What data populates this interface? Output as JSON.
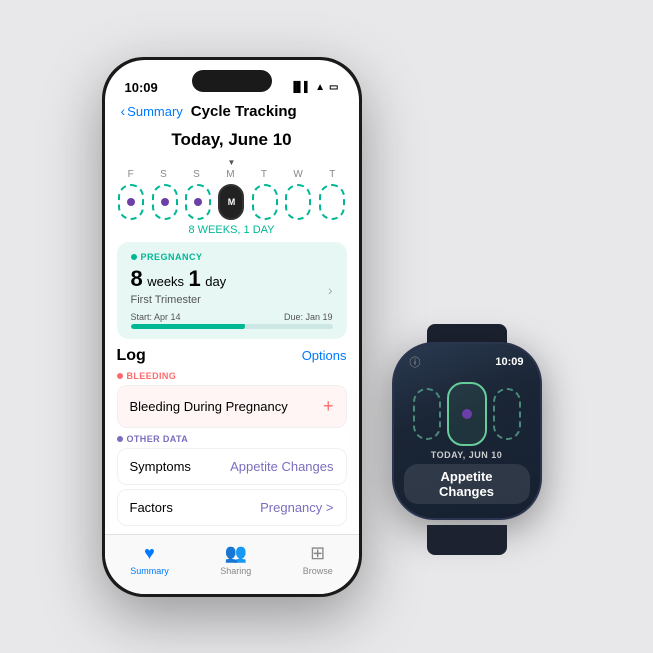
{
  "background_color": "#e8e8ea",
  "iphone": {
    "status_bar": {
      "time": "10:09",
      "signal": "●●●",
      "wifi": "wifi",
      "battery": "battery"
    },
    "nav": {
      "back_label": "Summary",
      "title": "Cycle Tracking"
    },
    "date_header": "Today, June 10",
    "calendar": {
      "day_labels": [
        "F",
        "S",
        "S",
        "M",
        "T",
        "W",
        "T"
      ],
      "today_marker": "M",
      "week_label": "8 WEEKS, 1 DAY"
    },
    "pregnancy_card": {
      "category": "PREGNANCY",
      "weeks": "8",
      "weeks_unit": "weeks",
      "days": "1",
      "days_unit": "day",
      "trimester": "First Trimester",
      "start_label": "Start: Apr 14",
      "due_label": "Due: Jan 19",
      "progress_percent": 55
    },
    "log_section": {
      "title": "Log",
      "options_label": "Options",
      "bleeding_category": "BLEEDING",
      "bleeding_row_label": "Bleeding During Pregnancy",
      "other_category": "OTHER DATA",
      "symptoms_label": "Symptoms",
      "symptoms_value": "Appetite Changes",
      "factors_label": "Factors",
      "factors_value": "Pregnancy >"
    },
    "tab_bar": {
      "tabs": [
        {
          "label": "Summary",
          "active": true,
          "icon": "♥"
        },
        {
          "label": "Sharing",
          "active": false,
          "icon": "👥"
        },
        {
          "label": "Browse",
          "active": false,
          "icon": "⊞"
        }
      ]
    }
  },
  "watch": {
    "status_bar": {
      "time": "10:09"
    },
    "date_label": "TODAY, JUN 10",
    "value_label": "Appetite Changes"
  }
}
